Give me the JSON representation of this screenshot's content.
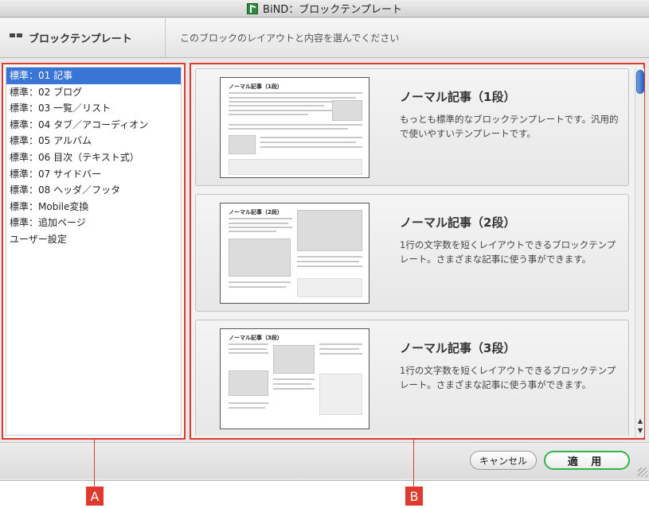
{
  "window": {
    "title": "BiND：ブロックテンプレート"
  },
  "toolbar": {
    "section_title": "ブロックテンプレート",
    "instruction": "このブロックのレイアウトと内容を選んでください"
  },
  "categories": [
    {
      "label": "標準：01 記事",
      "selected": true
    },
    {
      "label": "標準：02 ブログ",
      "selected": false
    },
    {
      "label": "標準：03 一覧／リスト",
      "selected": false
    },
    {
      "label": "標準：04 タブ／アコーディオン",
      "selected": false
    },
    {
      "label": "標準：05 アルバム",
      "selected": false
    },
    {
      "label": "標準：06 目次（テキスト式）",
      "selected": false
    },
    {
      "label": "標準：07 サイドバー",
      "selected": false
    },
    {
      "label": "標準：08 ヘッダ／フッタ",
      "selected": false
    },
    {
      "label": "標準：Mobile変換",
      "selected": false
    },
    {
      "label": "標準：追加ページ",
      "selected": false
    },
    {
      "label": "ユーザー設定",
      "selected": false
    }
  ],
  "templates": [
    {
      "title": "ノーマル記事（1段）",
      "description": "もっとも標準的なブロックテンプレートです。汎用的で使いやすいテンプレートです。",
      "thumb_title": "ノーマル記事（1段）"
    },
    {
      "title": "ノーマル記事（2段）",
      "description": "1行の文字数を短くレイアウトできるブロックテンプレート。さまざまな記事に使う事ができます。",
      "thumb_title": "ノーマル記事（2段）"
    },
    {
      "title": "ノーマル記事（3段）",
      "description": "1行の文字数を短くレイアウトできるブロックテンプレート。さまざまな記事に使う事ができます。",
      "thumb_title": "ノーマル記事（3段）"
    }
  ],
  "buttons": {
    "cancel": "キャンセル",
    "apply": "適 用"
  },
  "callouts": {
    "a": "A",
    "b": "B"
  },
  "colors": {
    "selection": "#3875d7",
    "highlight_frame": "#e03a2e",
    "apply_border": "#33b34a"
  }
}
